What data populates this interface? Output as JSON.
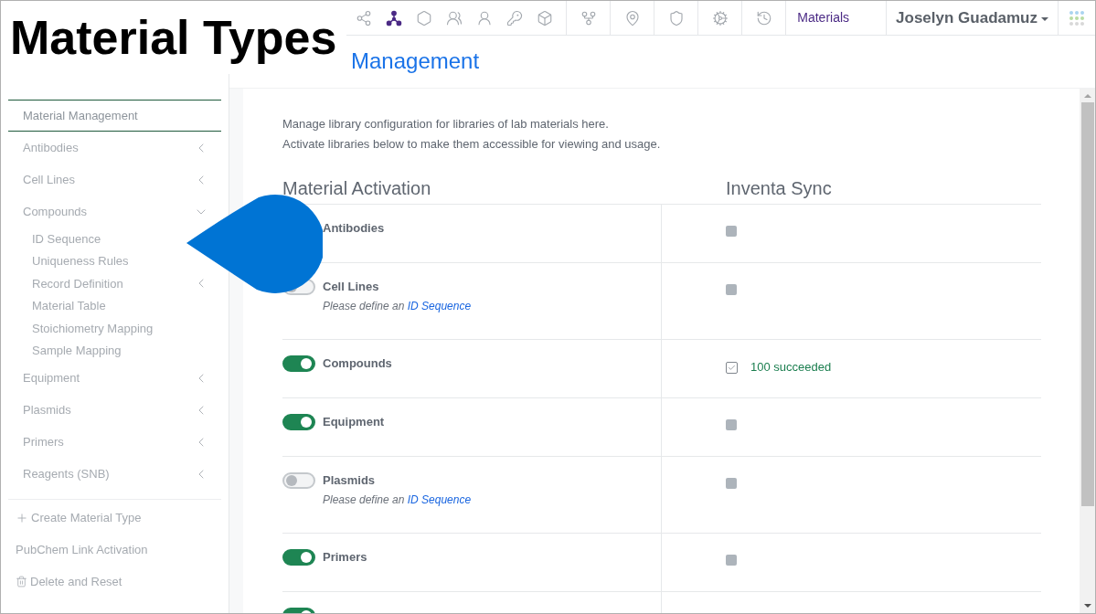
{
  "annotation": {
    "label": "Material Types"
  },
  "toolbar": [
    {
      "selected": false
    },
    {
      "selected": true
    },
    {
      "selected": false
    },
    {
      "selected": false
    },
    {
      "selected": false
    },
    {
      "selected": false
    },
    {
      "selected": false
    },
    {
      "selected": false
    },
    {
      "selected": false
    },
    {
      "selected": false
    },
    {
      "selected": false
    },
    {
      "selected": false
    }
  ],
  "nav_link": "Materials",
  "user": "Joselyn Guadamuz",
  "page_title": "Management",
  "sidebar": {
    "items": [
      {
        "label": "Material Management",
        "selected": true
      },
      {
        "label": "Antibodies",
        "selected": false,
        "expanded": false
      },
      {
        "label": "Cell Lines",
        "selected": false,
        "expanded": false
      },
      {
        "label": "Compounds",
        "selected": false,
        "expanded": true,
        "children": [
          {
            "label": "ID Sequence",
            "selected": false
          },
          {
            "label": "Uniqueness Rules",
            "selected": false
          },
          {
            "label": "Record Definition",
            "selected": false,
            "expanded": false
          },
          {
            "label": "Material Table",
            "selected": false
          },
          {
            "label": "Stoichiometry Mapping",
            "selected": false
          },
          {
            "label": "Sample Mapping",
            "selected": false
          }
        ]
      },
      {
        "label": "Equipment",
        "selected": false,
        "expanded": false
      },
      {
        "label": "Plasmids",
        "selected": false,
        "expanded": false
      },
      {
        "label": "Primers",
        "selected": false,
        "expanded": false
      },
      {
        "label": "Reagents (SNB)",
        "selected": false,
        "expanded": false
      }
    ],
    "actions": [
      {
        "kind": "create",
        "label": "Create Material Type"
      },
      {
        "kind": "link",
        "label": "PubChem Link Activation"
      },
      {
        "kind": "delete",
        "label": "Delete and Reset"
      }
    ]
  },
  "description": [
    "Manage library configuration for libraries of lab materials here.",
    "Activate libraries below to make them accessible for viewing and usage."
  ],
  "table": {
    "columns": [
      "Material Activation",
      "Inventa Sync"
    ],
    "rows": [
      {
        "name": "Antibodies",
        "sync": {
          "checked": false
        }
      },
      {
        "name": "Cell Lines",
        "on": false,
        "hint": "Please define an",
        "hint_link": "ID Sequence",
        "sync": {
          "checked": false
        }
      },
      {
        "name": "Compounds",
        "on": true,
        "sync": {
          "checked": true,
          "status": "100 succeeded"
        }
      },
      {
        "name": "Equipment",
        "on": true,
        "sync": {
          "checked": false
        }
      },
      {
        "name": "Plasmids",
        "on": false,
        "hint": "Please define an",
        "hint_link": "ID Sequence",
        "sync": {
          "checked": false
        }
      },
      {
        "name": "Primers",
        "on": true,
        "sync": {
          "checked": false
        }
      },
      {
        "on": true
      }
    ]
  }
}
